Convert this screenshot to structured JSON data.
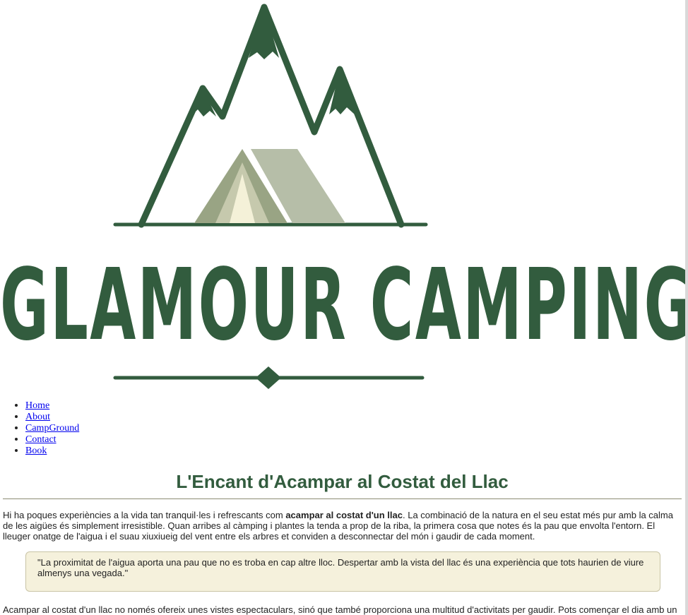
{
  "brand": {
    "name": "GLAMOUR CAMPING",
    "colors": {
      "primary": "#325c3e",
      "tent_light": "#b6bea8",
      "tent_mid": "#99a484",
      "tent_inner": "#f4f1d8"
    }
  },
  "nav": {
    "items": [
      {
        "label": "Home"
      },
      {
        "label": "About"
      },
      {
        "label": "CampGround"
      },
      {
        "label": "Contact"
      },
      {
        "label": "Book"
      }
    ]
  },
  "article": {
    "title": "L'Encant d'Acampar al Costat del Llac",
    "para1_pre": "Hi ha poques experiències a la vida tan tranquil·les i refrescants com ",
    "para1_bold": "acampar al costat d'un llac",
    "para1_post": ". La combinació de la natura en el seu estat més pur amb la calma de les aigües és simplement irresistible. Quan arribes al càmping i plantes la tenda a prop de la riba, la primera cosa que notes és la pau que envolta l'entorn. El lleuger onatge de l'aigua i el suau xiuxiueig del vent entre els arbres et conviden a desconnectar del món i gaudir de cada moment.",
    "quote": "\"La proximitat de l'aigua aporta una pau que no es troba en cap altre lloc. Despertar amb la vista del llac és una experiència que tots haurien de viure almenys una vegada.\"",
    "para2": "Acampar al costat d'un llac no només ofereix unes vistes espectaculars, sinó que també proporciona una multitud d'activitats per gaudir. Pots començar el dia amb una"
  }
}
